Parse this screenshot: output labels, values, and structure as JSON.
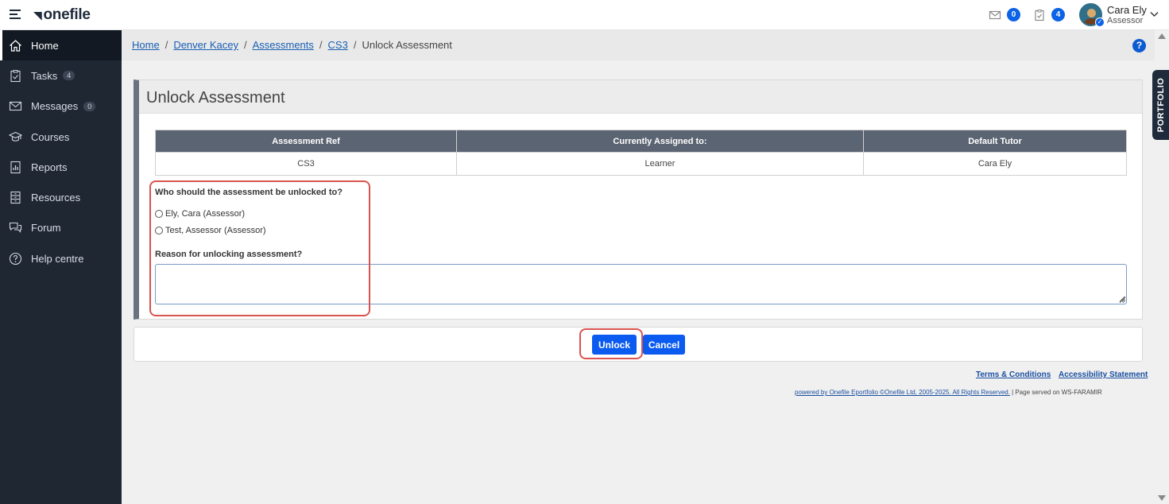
{
  "app": {
    "logo_text": "onefile"
  },
  "topbar": {
    "messages_count": "0",
    "tasks_count": "4",
    "user_name": "Cara Ely",
    "user_role": "Assessor"
  },
  "sidebar": {
    "items": [
      {
        "label": "Home",
        "icon": "home-icon",
        "active": true
      },
      {
        "label": "Tasks",
        "icon": "clipboard-icon",
        "count": "4"
      },
      {
        "label": "Messages",
        "icon": "envelope-icon",
        "count": "0"
      },
      {
        "label": "Courses",
        "icon": "graduation-cap-icon"
      },
      {
        "label": "Reports",
        "icon": "report-icon"
      },
      {
        "label": "Resources",
        "icon": "resources-icon"
      },
      {
        "label": "Forum",
        "icon": "forum-icon"
      },
      {
        "label": "Help centre",
        "icon": "help-circle-icon"
      }
    ]
  },
  "breadcrumb": {
    "items": [
      "Home",
      "Denver Kacey",
      "Assessments",
      "CS3"
    ],
    "current": "Unlock Assessment",
    "separator": "/"
  },
  "portfolio_tab": "PORTFOLIO",
  "panel": {
    "title": "Unlock Assessment",
    "table": {
      "headers": [
        "Assessment Ref",
        "Currently Assigned to:",
        "Default Tutor"
      ],
      "row": [
        "CS3",
        "Learner",
        "Cara Ely"
      ]
    },
    "question": "Who should the assessment be unlocked to?",
    "options": [
      "Ely, Cara (Assessor)",
      "Test, Assessor (Assessor)"
    ],
    "reason_label": "Reason for unlocking assessment?",
    "reason_value": ""
  },
  "actions": {
    "unlock": "Unlock",
    "cancel": "Cancel"
  },
  "footer": {
    "terms": "Terms & Conditions",
    "accessibility": "Accessibility Statement",
    "powered_by": "powered by Onefile Eportfolio ©Onefile Ltd, 2005-2025. All Rights Reserved.",
    "served": " | Page served on WS-FARAMIR"
  },
  "colors": {
    "accent": "#0b5bf0",
    "sidebar_bg": "#1f2733",
    "highlight": "#d9534f"
  }
}
